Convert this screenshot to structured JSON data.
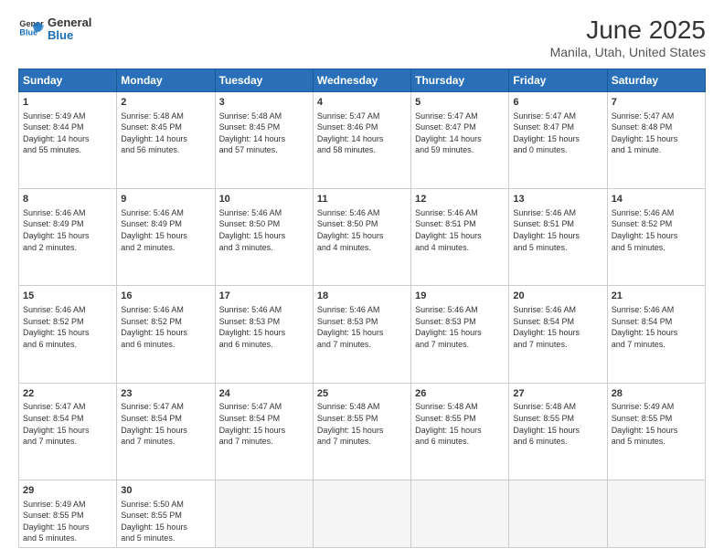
{
  "logo": {
    "line1": "General",
    "line2": "Blue"
  },
  "title": "June 2025",
  "subtitle": "Manila, Utah, United States",
  "header_days": [
    "Sunday",
    "Monday",
    "Tuesday",
    "Wednesday",
    "Thursday",
    "Friday",
    "Saturday"
  ],
  "weeks": [
    [
      {
        "day": "1",
        "info": "Sunrise: 5:49 AM\nSunset: 8:44 PM\nDaylight: 14 hours\nand 55 minutes."
      },
      {
        "day": "2",
        "info": "Sunrise: 5:48 AM\nSunset: 8:45 PM\nDaylight: 14 hours\nand 56 minutes."
      },
      {
        "day": "3",
        "info": "Sunrise: 5:48 AM\nSunset: 8:45 PM\nDaylight: 14 hours\nand 57 minutes."
      },
      {
        "day": "4",
        "info": "Sunrise: 5:47 AM\nSunset: 8:46 PM\nDaylight: 14 hours\nand 58 minutes."
      },
      {
        "day": "5",
        "info": "Sunrise: 5:47 AM\nSunset: 8:47 PM\nDaylight: 14 hours\nand 59 minutes."
      },
      {
        "day": "6",
        "info": "Sunrise: 5:47 AM\nSunset: 8:47 PM\nDaylight: 15 hours\nand 0 minutes."
      },
      {
        "day": "7",
        "info": "Sunrise: 5:47 AM\nSunset: 8:48 PM\nDaylight: 15 hours\nand 1 minute."
      }
    ],
    [
      {
        "day": "8",
        "info": "Sunrise: 5:46 AM\nSunset: 8:49 PM\nDaylight: 15 hours\nand 2 minutes."
      },
      {
        "day": "9",
        "info": "Sunrise: 5:46 AM\nSunset: 8:49 PM\nDaylight: 15 hours\nand 2 minutes."
      },
      {
        "day": "10",
        "info": "Sunrise: 5:46 AM\nSunset: 8:50 PM\nDaylight: 15 hours\nand 3 minutes."
      },
      {
        "day": "11",
        "info": "Sunrise: 5:46 AM\nSunset: 8:50 PM\nDaylight: 15 hours\nand 4 minutes."
      },
      {
        "day": "12",
        "info": "Sunrise: 5:46 AM\nSunset: 8:51 PM\nDaylight: 15 hours\nand 4 minutes."
      },
      {
        "day": "13",
        "info": "Sunrise: 5:46 AM\nSunset: 8:51 PM\nDaylight: 15 hours\nand 5 minutes."
      },
      {
        "day": "14",
        "info": "Sunrise: 5:46 AM\nSunset: 8:52 PM\nDaylight: 15 hours\nand 5 minutes."
      }
    ],
    [
      {
        "day": "15",
        "info": "Sunrise: 5:46 AM\nSunset: 8:52 PM\nDaylight: 15 hours\nand 6 minutes."
      },
      {
        "day": "16",
        "info": "Sunrise: 5:46 AM\nSunset: 8:52 PM\nDaylight: 15 hours\nand 6 minutes."
      },
      {
        "day": "17",
        "info": "Sunrise: 5:46 AM\nSunset: 8:53 PM\nDaylight: 15 hours\nand 6 minutes."
      },
      {
        "day": "18",
        "info": "Sunrise: 5:46 AM\nSunset: 8:53 PM\nDaylight: 15 hours\nand 7 minutes."
      },
      {
        "day": "19",
        "info": "Sunrise: 5:46 AM\nSunset: 8:53 PM\nDaylight: 15 hours\nand 7 minutes."
      },
      {
        "day": "20",
        "info": "Sunrise: 5:46 AM\nSunset: 8:54 PM\nDaylight: 15 hours\nand 7 minutes."
      },
      {
        "day": "21",
        "info": "Sunrise: 5:46 AM\nSunset: 8:54 PM\nDaylight: 15 hours\nand 7 minutes."
      }
    ],
    [
      {
        "day": "22",
        "info": "Sunrise: 5:47 AM\nSunset: 8:54 PM\nDaylight: 15 hours\nand 7 minutes."
      },
      {
        "day": "23",
        "info": "Sunrise: 5:47 AM\nSunset: 8:54 PM\nDaylight: 15 hours\nand 7 minutes."
      },
      {
        "day": "24",
        "info": "Sunrise: 5:47 AM\nSunset: 8:54 PM\nDaylight: 15 hours\nand 7 minutes."
      },
      {
        "day": "25",
        "info": "Sunrise: 5:48 AM\nSunset: 8:55 PM\nDaylight: 15 hours\nand 7 minutes."
      },
      {
        "day": "26",
        "info": "Sunrise: 5:48 AM\nSunset: 8:55 PM\nDaylight: 15 hours\nand 6 minutes."
      },
      {
        "day": "27",
        "info": "Sunrise: 5:48 AM\nSunset: 8:55 PM\nDaylight: 15 hours\nand 6 minutes."
      },
      {
        "day": "28",
        "info": "Sunrise: 5:49 AM\nSunset: 8:55 PM\nDaylight: 15 hours\nand 5 minutes."
      }
    ],
    [
      {
        "day": "29",
        "info": "Sunrise: 5:49 AM\nSunset: 8:55 PM\nDaylight: 15 hours\nand 5 minutes."
      },
      {
        "day": "30",
        "info": "Sunrise: 5:50 AM\nSunset: 8:55 PM\nDaylight: 15 hours\nand 5 minutes."
      },
      {
        "day": "",
        "info": ""
      },
      {
        "day": "",
        "info": ""
      },
      {
        "day": "",
        "info": ""
      },
      {
        "day": "",
        "info": ""
      },
      {
        "day": "",
        "info": ""
      }
    ]
  ]
}
